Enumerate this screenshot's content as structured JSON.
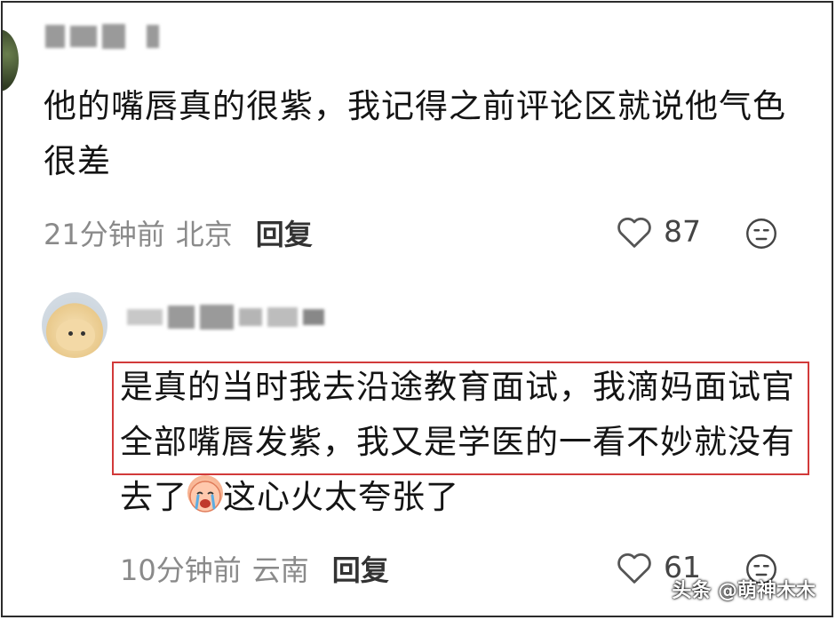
{
  "comments": [
    {
      "text": "他的嘴唇真的很紫，我记得之前评论区就说他气色很差",
      "time": "21分钟前",
      "location": "北京",
      "reply_label": "回复",
      "likes": "87"
    },
    {
      "text_part1": "是真的当时我去沿途教育面试，我滴妈面试官全部嘴唇发紫，我又是学医的一看不妙就没有去了",
      "text_part2": "这心火太夸张了",
      "time": "10分钟前",
      "location": "云南",
      "reply_label": "回复",
      "likes": "61"
    }
  ],
  "watermark": "头条 @萌神木木",
  "colors": {
    "highlight_border": "#d23a3a",
    "meta_text": "#8a8a8a"
  },
  "icons": [
    "heart-icon",
    "dislike-face-icon",
    "crying-emoji-icon"
  ]
}
